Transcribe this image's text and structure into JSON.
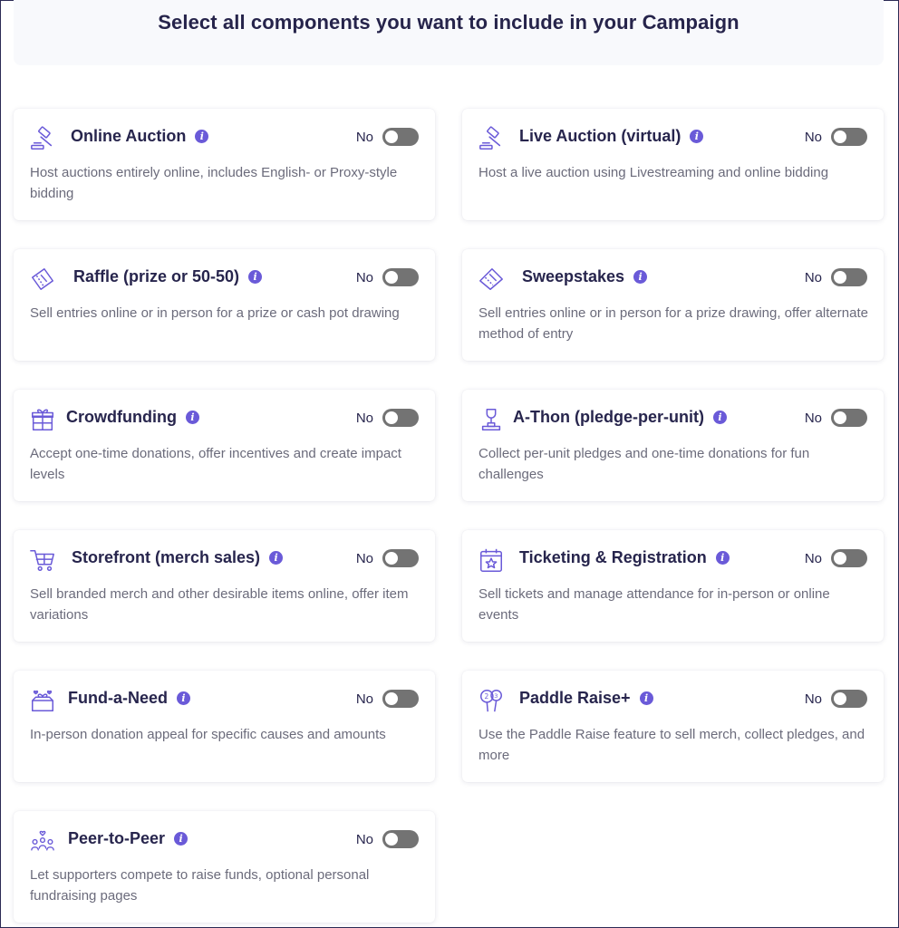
{
  "header": {
    "title": "Select all components you want to include in your Campaign"
  },
  "colors": {
    "accent": "#6a5ad8",
    "title": "#27254d",
    "toggle_off": "#737373"
  },
  "cards": [
    {
      "icon": "gavel-icon",
      "title": "Online Auction",
      "toggle": "No",
      "desc": "Host auctions entirely online, includes English- or Proxy-style bidding"
    },
    {
      "icon": "gavel-icon",
      "title": "Live Auction (virtual)",
      "toggle": "No",
      "desc": "Host a live auction using Livestreaming and online bidding"
    },
    {
      "icon": "ticket-icon",
      "title": "Raffle (prize or 50-50)",
      "toggle": "No",
      "desc": "Sell entries online or in person for a prize or cash pot drawing"
    },
    {
      "icon": "ticket-icon",
      "title": "Sweepstakes",
      "toggle": "No",
      "desc": "Sell entries online or in person for a prize drawing, offer alternate method of entry"
    },
    {
      "icon": "gift-icon",
      "title": "Crowdfunding",
      "toggle": "No",
      "desc": "Accept one-time donations, offer incentives and create impact levels"
    },
    {
      "icon": "trophy-icon",
      "title": "A-Thon (pledge-per-unit)",
      "toggle": "No",
      "desc": "Collect per-unit pledges and one-time donations for fun challenges"
    },
    {
      "icon": "cart-icon",
      "title": "Storefront (merch sales)",
      "toggle": "No",
      "desc": "Sell branded merch and other desirable items online, offer item variations"
    },
    {
      "icon": "calendar-icon",
      "title": "Ticketing & Registration",
      "toggle": "No",
      "desc": "Sell tickets and manage attendance for in-person or online events"
    },
    {
      "icon": "heart-box-icon",
      "title": "Fund-a-Need",
      "toggle": "No",
      "desc": "In-person donation appeal for specific causes and amounts"
    },
    {
      "icon": "paddle-icon",
      "title": "Paddle Raise+",
      "toggle": "No",
      "desc": "Use the Paddle Raise feature to sell merch, collect pledges, and more"
    },
    {
      "icon": "people-icon",
      "title": "Peer-to-Peer",
      "toggle": "No",
      "desc": "Let supporters compete to raise funds, optional personal fundraising pages"
    }
  ]
}
